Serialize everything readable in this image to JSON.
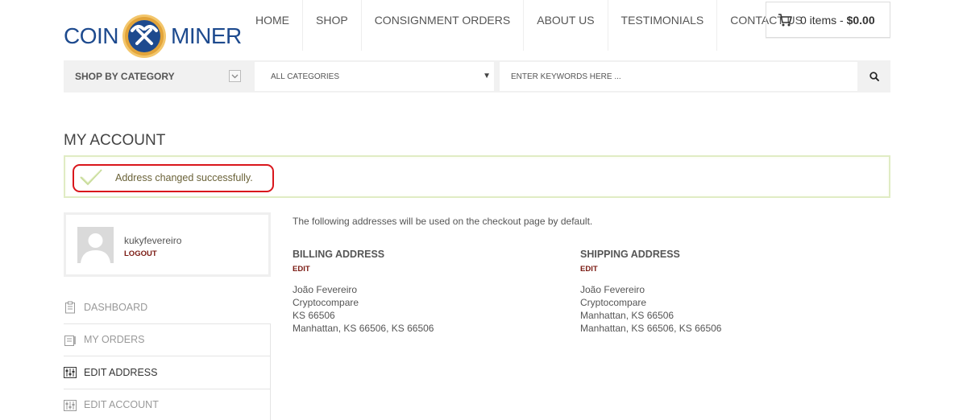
{
  "brand": {
    "left_text": "COIN",
    "right_text": "MINER",
    "colors": {
      "primary": "#1d4a8e",
      "gold": "#e2a43a"
    }
  },
  "nav": {
    "items": [
      {
        "label": "HOME"
      },
      {
        "label": "SHOP"
      },
      {
        "label": "CONSIGNMENT ORDERS"
      },
      {
        "label": "ABOUT US"
      },
      {
        "label": "TESTIMONIALS"
      },
      {
        "label": "CONTACT US"
      }
    ]
  },
  "cart": {
    "icon": "cart-icon",
    "items_label": "0 items",
    "separator": " - ",
    "total": "$0.00"
  },
  "searchbar": {
    "shop_by_category": "SHOP BY CATEGORY",
    "category_selected": "ALL CATEGORIES",
    "search_placeholder": "ENTER KEYWORDS HERE ...",
    "search_icon": "search-icon"
  },
  "page": {
    "title": "MY ACCOUNT"
  },
  "notice": {
    "text": "Address changed successfully.",
    "icon": "checkmark-icon",
    "colors": {
      "border": "#e0ecc4",
      "highlight": "#d9161c"
    }
  },
  "user": {
    "username": "kukyfevereiro",
    "logout_label": "LOGOUT"
  },
  "sidebar": {
    "items": [
      {
        "label": "DASHBOARD",
        "icon": "clipboard-icon",
        "active": false
      },
      {
        "label": "MY ORDERS",
        "icon": "orders-icon",
        "active": false
      },
      {
        "label": "EDIT ADDRESS",
        "icon": "sliders-icon",
        "active": true
      },
      {
        "label": "EDIT ACCOUNT",
        "icon": "sliders-icon",
        "active": false
      }
    ]
  },
  "addresses": {
    "intro": "The following addresses will be used on the checkout page by default.",
    "billing": {
      "title": "BILLING ADDRESS",
      "edit_label": "EDIT",
      "lines": [
        "João Fevereiro",
        "Cryptocompare",
        "KS 66506",
        "Manhattan, KS 66506, KS 66506"
      ]
    },
    "shipping": {
      "title": "SHIPPING ADDRESS",
      "edit_label": "EDIT",
      "lines": [
        "João Fevereiro",
        "Cryptocompare",
        "Manhattan, KS 66506",
        "Manhattan, KS 66506, KS 66506"
      ]
    }
  }
}
